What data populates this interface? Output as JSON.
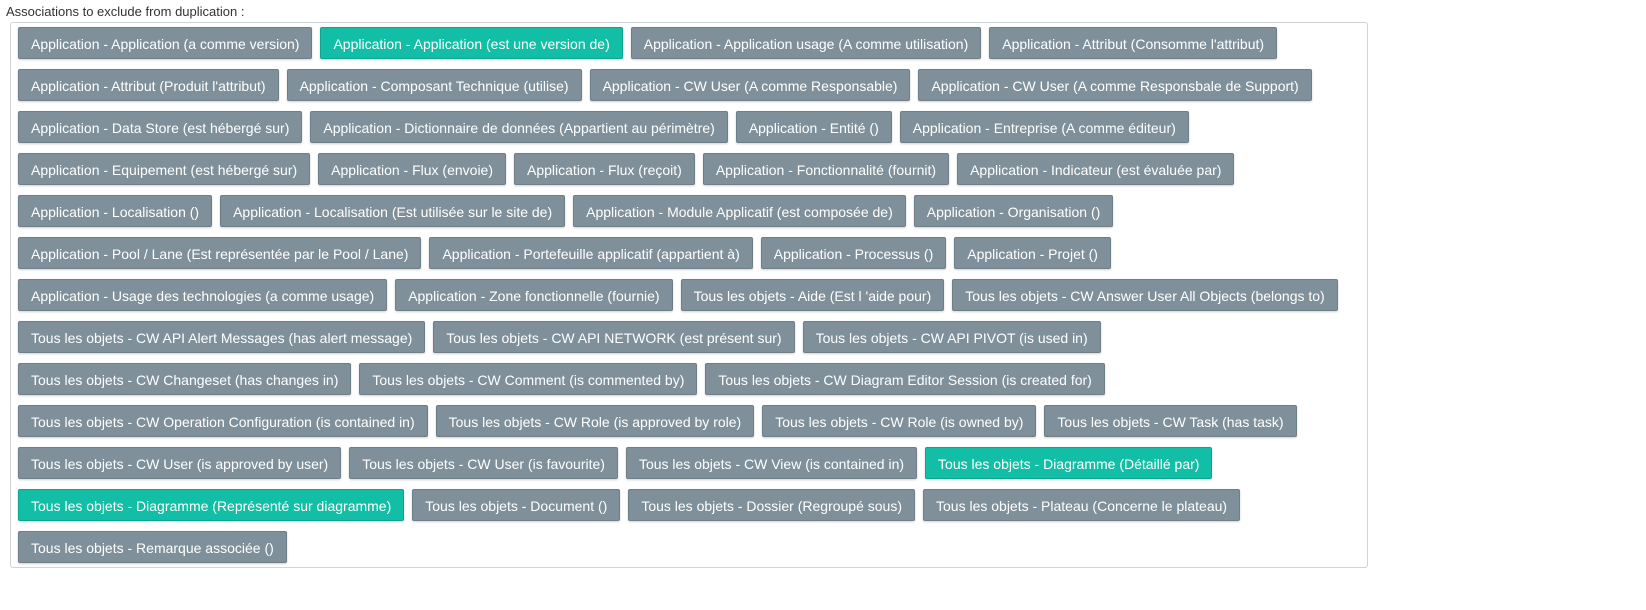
{
  "label": "Associations to exclude from duplication :",
  "colors": {
    "chip": "#7f909a",
    "chip_selected": "#12bfa6"
  },
  "chips": [
    {
      "text": "Application - Application (a comme version)",
      "selected": false
    },
    {
      "text": "Application - Application (est une version de)",
      "selected": true
    },
    {
      "text": "Application - Application usage (A comme utilisation)",
      "selected": false
    },
    {
      "text": "Application - Attribut (Consomme l'attribut)",
      "selected": false
    },
    {
      "text": "Application - Attribut (Produit l'attribut)",
      "selected": false
    },
    {
      "text": "Application - Composant Technique (utilise)",
      "selected": false
    },
    {
      "text": "Application - CW User (A comme Responsable)",
      "selected": false
    },
    {
      "text": "Application - CW User (A comme Responsbale de Support)",
      "selected": false
    },
    {
      "text": "Application - Data Store (est hébergé sur)",
      "selected": false
    },
    {
      "text": "Application - Dictionnaire de données (Appartient au périmètre)",
      "selected": false
    },
    {
      "text": "Application - Entité ()",
      "selected": false
    },
    {
      "text": "Application - Entreprise (A comme éditeur)",
      "selected": false
    },
    {
      "text": "Application - Equipement (est hébergé sur)",
      "selected": false
    },
    {
      "text": "Application - Flux (envoie)",
      "selected": false
    },
    {
      "text": "Application - Flux (reçoit)",
      "selected": false
    },
    {
      "text": "Application - Fonctionnalité (fournit)",
      "selected": false
    },
    {
      "text": "Application - Indicateur (est évaluée par)",
      "selected": false
    },
    {
      "text": "Application - Localisation ()",
      "selected": false
    },
    {
      "text": "Application - Localisation (Est utilisée sur le site de)",
      "selected": false
    },
    {
      "text": "Application - Module Applicatif (est composée de)",
      "selected": false
    },
    {
      "text": "Application - Organisation ()",
      "selected": false
    },
    {
      "text": "Application - Pool / Lane (Est représentée par le Pool / Lane)",
      "selected": false
    },
    {
      "text": "Application - Portefeuille applicatif (appartient à)",
      "selected": false
    },
    {
      "text": "Application - Processus ()",
      "selected": false
    },
    {
      "text": "Application - Projet ()",
      "selected": false
    },
    {
      "text": "Application - Usage des technologies (a comme usage)",
      "selected": false
    },
    {
      "text": "Application - Zone fonctionnelle (fournie)",
      "selected": false
    },
    {
      "text": "Tous les objets - Aide (Est l 'aide pour)",
      "selected": false
    },
    {
      "text": "Tous les objets - CW Answer User All Objects (belongs to)",
      "selected": false
    },
    {
      "text": "Tous les objets - CW API Alert Messages (has alert message)",
      "selected": false
    },
    {
      "text": "Tous les objets - CW API NETWORK (est présent sur)",
      "selected": false
    },
    {
      "text": "Tous les objets - CW API PIVOT (is used in)",
      "selected": false
    },
    {
      "text": "Tous les objets - CW Changeset (has changes in)",
      "selected": false
    },
    {
      "text": "Tous les objets - CW Comment (is commented by)",
      "selected": false
    },
    {
      "text": "Tous les objets - CW Diagram Editor Session (is created for)",
      "selected": false
    },
    {
      "text": "Tous les objets - CW Operation Configuration (is contained in)",
      "selected": false
    },
    {
      "text": "Tous les objets - CW Role (is approved by role)",
      "selected": false
    },
    {
      "text": "Tous les objets - CW Role (is owned by)",
      "selected": false
    },
    {
      "text": "Tous les objets - CW Task (has task)",
      "selected": false
    },
    {
      "text": "Tous les objets - CW User (is approved by user)",
      "selected": false
    },
    {
      "text": "Tous les objets - CW User (is favourite)",
      "selected": false
    },
    {
      "text": "Tous les objets - CW View (is contained in)",
      "selected": false
    },
    {
      "text": "Tous les objets - Diagramme (Détaillé par)",
      "selected": true
    },
    {
      "text": "Tous les objets - Diagramme (Représenté sur diagramme)",
      "selected": true
    },
    {
      "text": "Tous les objets - Document ()",
      "selected": false
    },
    {
      "text": "Tous les objets - Dossier (Regroupé sous)",
      "selected": false
    },
    {
      "text": "Tous les objets - Plateau (Concerne le plateau)",
      "selected": false
    },
    {
      "text": "Tous les objets - Remarque associée ()",
      "selected": false
    }
  ]
}
